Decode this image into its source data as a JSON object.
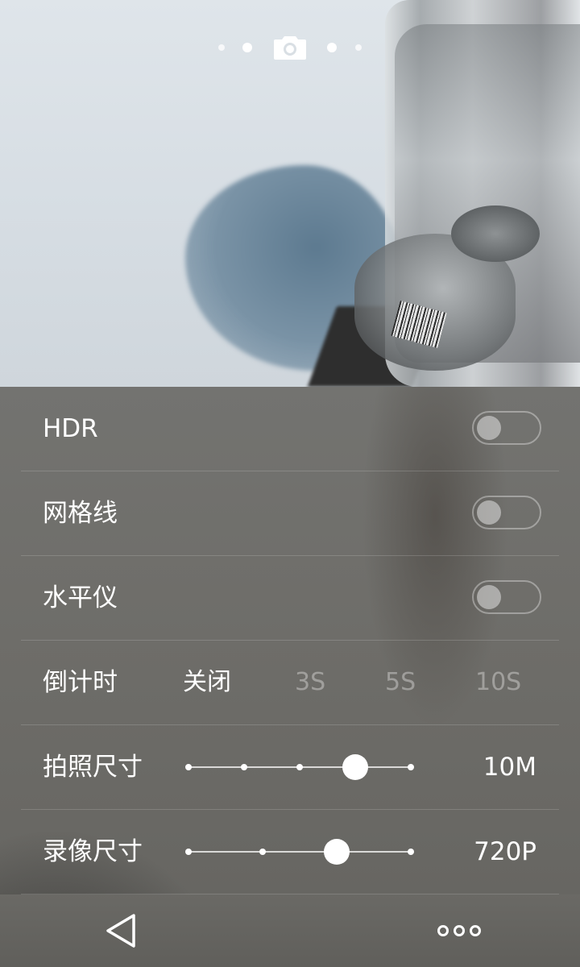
{
  "mode_indicator": {
    "icon": "camera-icon"
  },
  "settings": {
    "hdr": {
      "label": "HDR",
      "on": false
    },
    "grid": {
      "label": "网格线",
      "on": false
    },
    "level": {
      "label": "水平仪",
      "on": false
    },
    "timer": {
      "label": "倒计时",
      "options": [
        "关闭",
        "3S",
        "5S",
        "10S"
      ],
      "selected": "关闭"
    },
    "photo_size": {
      "label": "拍照尺寸",
      "value": "10M",
      "position": 3,
      "steps": 5
    },
    "video_size": {
      "label": "录像尺寸",
      "value": "720P",
      "position": 2,
      "steps": 4
    }
  },
  "navbar": {
    "back_icon": "back-triangle-icon",
    "more_icon": "more-dots-icon"
  },
  "colors": {
    "text": "#ffffff",
    "inactive_text": "rgba(255,255,255,0.35)"
  }
}
